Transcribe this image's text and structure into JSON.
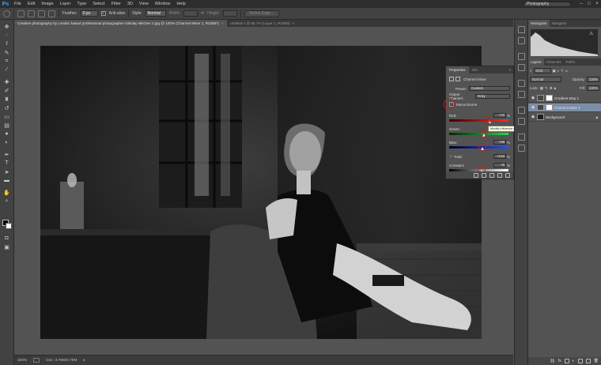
{
  "app": {
    "logo": "Ps",
    "menu": [
      "File",
      "Edit",
      "Image",
      "Layer",
      "Type",
      "Select",
      "Filter",
      "3D",
      "View",
      "Window",
      "Help"
    ],
    "workspace": "Photography",
    "window_controls": [
      "–",
      "□",
      "×"
    ]
  },
  "options_bar": {
    "feather_label": "Feather:",
    "feather_value": "0 px",
    "anti_alias_label": "Anti-alias",
    "anti_alias_checked": true,
    "style_label": "Style:",
    "style_value": "Normal",
    "width_label": "Width:",
    "height_label": "Height:",
    "refine_edge_label": "Refine Edge..."
  },
  "doc_tabs": [
    {
      "label": "Creative photography by London based professional photographer Nikolay Mirchev 2.jpg @ 100% (Channel Mixer 1, RGB/8*)",
      "active": true
    },
    {
      "label": "Untitled-1 @ 66.7% (Layer 1, RGB/8)",
      "active": false
    }
  ],
  "status_bar": {
    "zoom": "100%",
    "doc": "Doc: 3.76M/3.76M"
  },
  "properties": {
    "tabs": [
      "Properties",
      "Info"
    ],
    "title": "Channel Mixer",
    "preset_label": "Preset:",
    "preset_value": "Custom",
    "output_label": "Output Channel:",
    "output_value": "Gray",
    "monochrome_label": "Monochrome",
    "monochrome_checked": true,
    "sliders": [
      {
        "label": "Red:",
        "value": "+72",
        "unit": "%",
        "level": 0.68
      },
      {
        "label": "Green:",
        "value": "+34",
        "unit": "%",
        "level": 0.59
      },
      {
        "label": "Blue:",
        "value": "+28",
        "unit": "%",
        "level": 0.57
      },
      {
        "label": "Total:",
        "value": "+134",
        "unit": "%",
        "level": 0.58
      },
      {
        "label": "Constant:",
        "value": "+5",
        "unit": "%",
        "level": 0.55
      }
    ]
  },
  "tooltip": "Modify influence of the red channel within the overall mix.",
  "histogram": {
    "tabs": [
      "Histogram",
      "Navigator"
    ]
  },
  "layers_panel": {
    "tabs": [
      "Layers",
      "Channels",
      "Paths"
    ],
    "kind_label": "Kind",
    "blend_mode": "Normal",
    "opacity_label": "Opacity:",
    "opacity_value": "100%",
    "lock_label": "Lock:",
    "fill_label": "Fill:",
    "fill_value": "100%",
    "layers": [
      {
        "name": "Gradient Map 1",
        "selected": false
      },
      {
        "name": "Channel Mixer 1",
        "selected": true
      },
      {
        "name": "Background",
        "selected": false
      }
    ]
  },
  "colors": {
    "accent_red": "#d11a1a",
    "selected_layer": "#7b8ea8",
    "ps_blue": "#31a8ff"
  }
}
